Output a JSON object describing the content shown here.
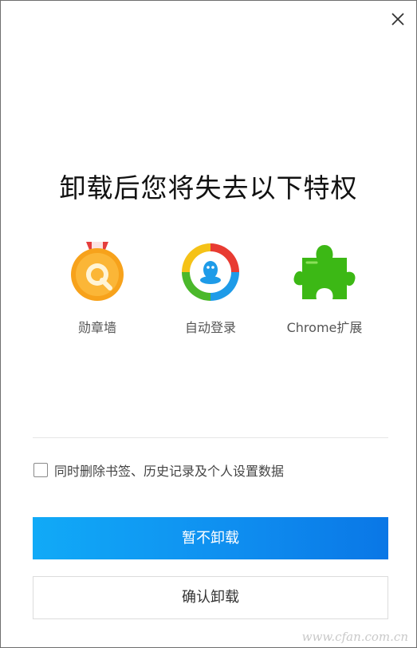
{
  "dialog": {
    "title": "卸载后您将失去以下特权",
    "close_icon": "close-icon"
  },
  "features": [
    {
      "label": "勋章墙",
      "icon": "medal-icon",
      "color": "#f7a21b"
    },
    {
      "label": "自动登录",
      "icon": "qq-circle-icon",
      "color": "#1e9be8"
    },
    {
      "label": "Chrome扩展",
      "icon": "puzzle-icon",
      "color": "#3cb815"
    }
  ],
  "options": {
    "delete_data_label": "同时删除书签、历史记录及个人设置数据",
    "delete_data_checked": false
  },
  "buttons": {
    "keep_label": "暂不卸载",
    "confirm_label": "确认卸载"
  },
  "watermark": "www.cfan.com.cn",
  "colors": {
    "primary": "#0f8ff0",
    "primary_start": "#11aaf7",
    "primary_end": "#0a77e6",
    "medal": "#f7a21b",
    "puzzle": "#3cb815"
  }
}
